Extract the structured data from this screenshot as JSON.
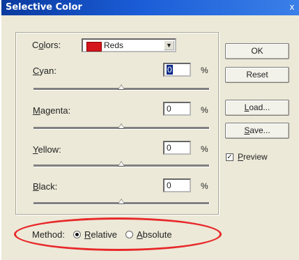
{
  "window": {
    "title": "Selective Color",
    "close": "x"
  },
  "colors": {
    "label_pre": "C",
    "label_under": "o",
    "label_post": "lors:",
    "value": "Reds",
    "swatch_color": "#d4161c"
  },
  "sliders": [
    {
      "label_under": "C",
      "label_post": "yan:",
      "value": "0",
      "unit": "%"
    },
    {
      "label_under": "M",
      "label_post": "agenta:",
      "value": "0",
      "unit": "%"
    },
    {
      "label_under": "Y",
      "label_post": "ellow:",
      "value": "0",
      "unit": "%"
    },
    {
      "label_under": "B",
      "label_post": "lack:",
      "value": "0",
      "unit": "%"
    }
  ],
  "buttons": {
    "ok": "OK",
    "reset": "Reset",
    "load_under": "L",
    "load_post": "oad...",
    "save_under": "S",
    "save_post": "ave..."
  },
  "preview": {
    "checked": true,
    "check_mark": "✓",
    "label_under": "P",
    "label_post": "review"
  },
  "method": {
    "label": "Method:",
    "relative_under": "R",
    "relative_post": "elative",
    "absolute_under": "A",
    "absolute_post": "bsolute",
    "selected": "relative"
  },
  "highlight_color": "#e8282a"
}
